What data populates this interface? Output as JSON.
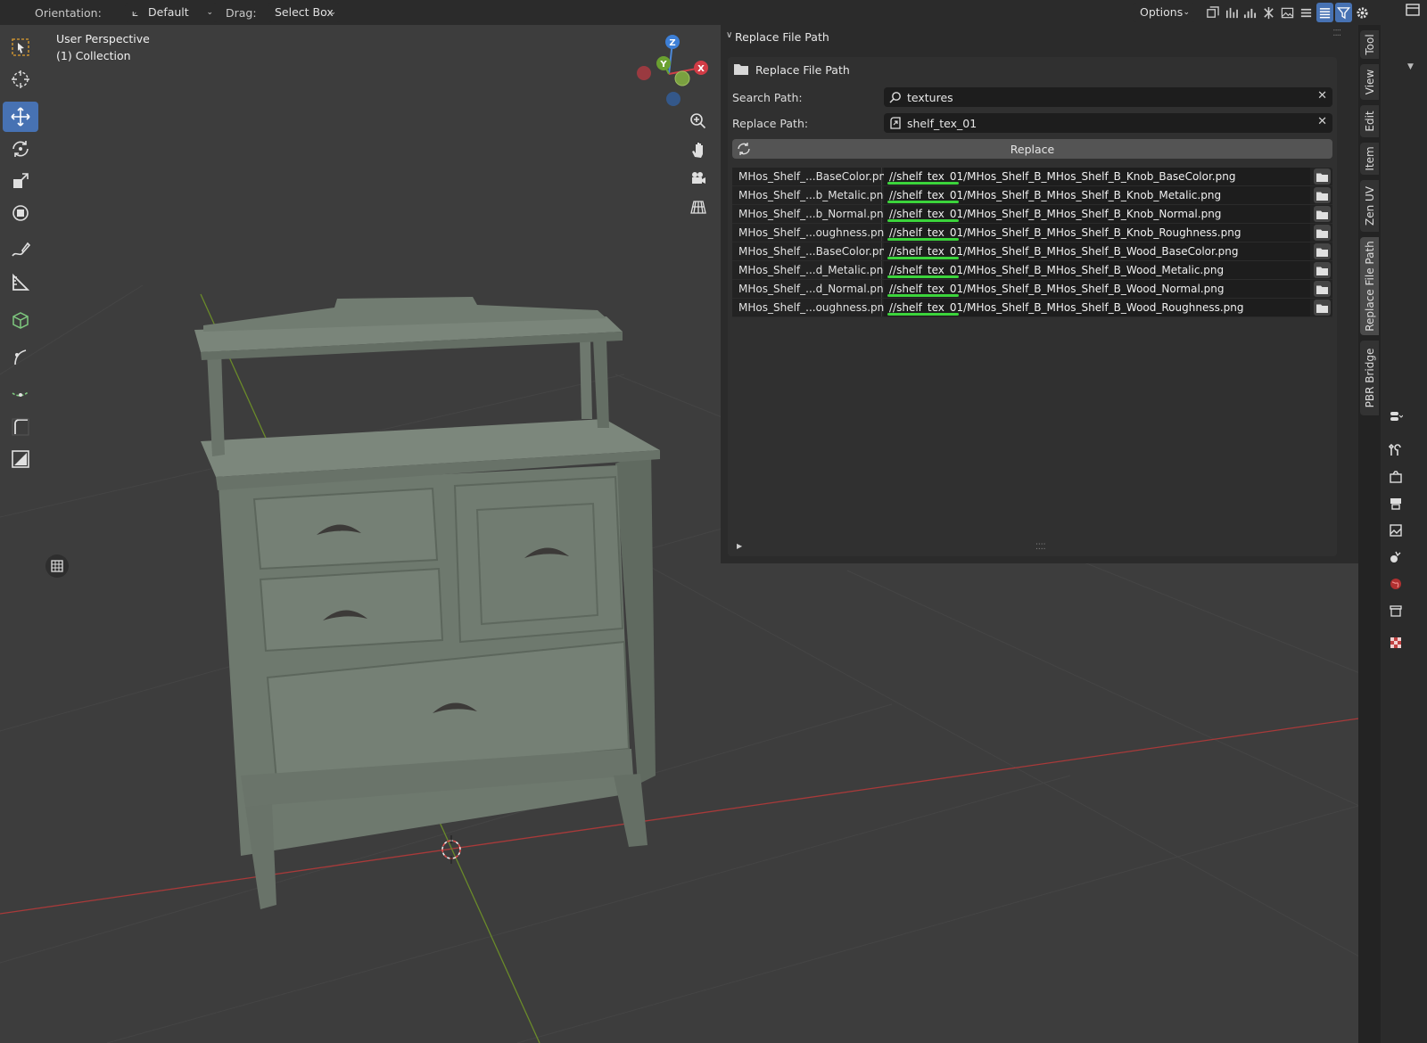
{
  "header": {
    "orientation_label": "Orientation:",
    "orientation_value": "Default",
    "drag_label": "Drag:",
    "drag_value": "Select Box",
    "options_label": "Options"
  },
  "viewport": {
    "view_name": "User Perspective",
    "collection": "(1) Collection",
    "gizmo": {
      "x": "X",
      "y": "Y",
      "z": "Z"
    }
  },
  "panel": {
    "title": "Replace File Path",
    "subpanel_title": "Replace File Path",
    "search_label": "Search Path:",
    "search_value": "textures",
    "replace_label": "Replace Path:",
    "replace_value": "shelf_tex_01",
    "replace_button": "Replace",
    "highlight_color": "#3bd43b",
    "files": [
      {
        "name": "MHos_Shelf_...BaseColor.png",
        "path": "//shelf_tex_01/MHos_Shelf_B_MHos_Shelf_B_Knob_BaseColor.png"
      },
      {
        "name": "MHos_Shelf_...b_Metalic.png",
        "path": "//shelf_tex_01/MHos_Shelf_B_MHos_Shelf_B_Knob_Metalic.png"
      },
      {
        "name": "MHos_Shelf_...b_Normal.png",
        "path": "//shelf_tex_01/MHos_Shelf_B_MHos_Shelf_B_Knob_Normal.png"
      },
      {
        "name": "MHos_Shelf_...oughness.png",
        "path": "//shelf_tex_01/MHos_Shelf_B_MHos_Shelf_B_Knob_Roughness.png"
      },
      {
        "name": "MHos_Shelf_...BaseColor.png",
        "path": "//shelf_tex_01/MHos_Shelf_B_MHos_Shelf_B_Wood_BaseColor.png"
      },
      {
        "name": "MHos_Shelf_...d_Metalic.png",
        "path": "//shelf_tex_01/MHos_Shelf_B_MHos_Shelf_B_Wood_Metalic.png"
      },
      {
        "name": "MHos_Shelf_...d_Normal.png",
        "path": "//shelf_tex_01/MHos_Shelf_B_MHos_Shelf_B_Wood_Normal.png"
      },
      {
        "name": "MHos_Shelf_...oughness.png",
        "path": "//shelf_tex_01/MHos_Shelf_B_MHos_Shelf_B_Wood_Roughness.png"
      }
    ]
  },
  "side_tabs": [
    "Tool",
    "View",
    "Edit",
    "Item",
    "Zen UV",
    "Replace File Path",
    "PBR Bridge"
  ],
  "toolbar_icons": [
    "select-box-icon",
    "cursor-icon",
    "move-icon",
    "rotate-icon",
    "scale-icon",
    "transform-icon",
    "annotate-icon",
    "measure-icon",
    "add-cube-icon",
    "shear-icon",
    "smooth-icon",
    "rip-icon",
    "shrink-icon"
  ],
  "accent_color": "#4772b3"
}
